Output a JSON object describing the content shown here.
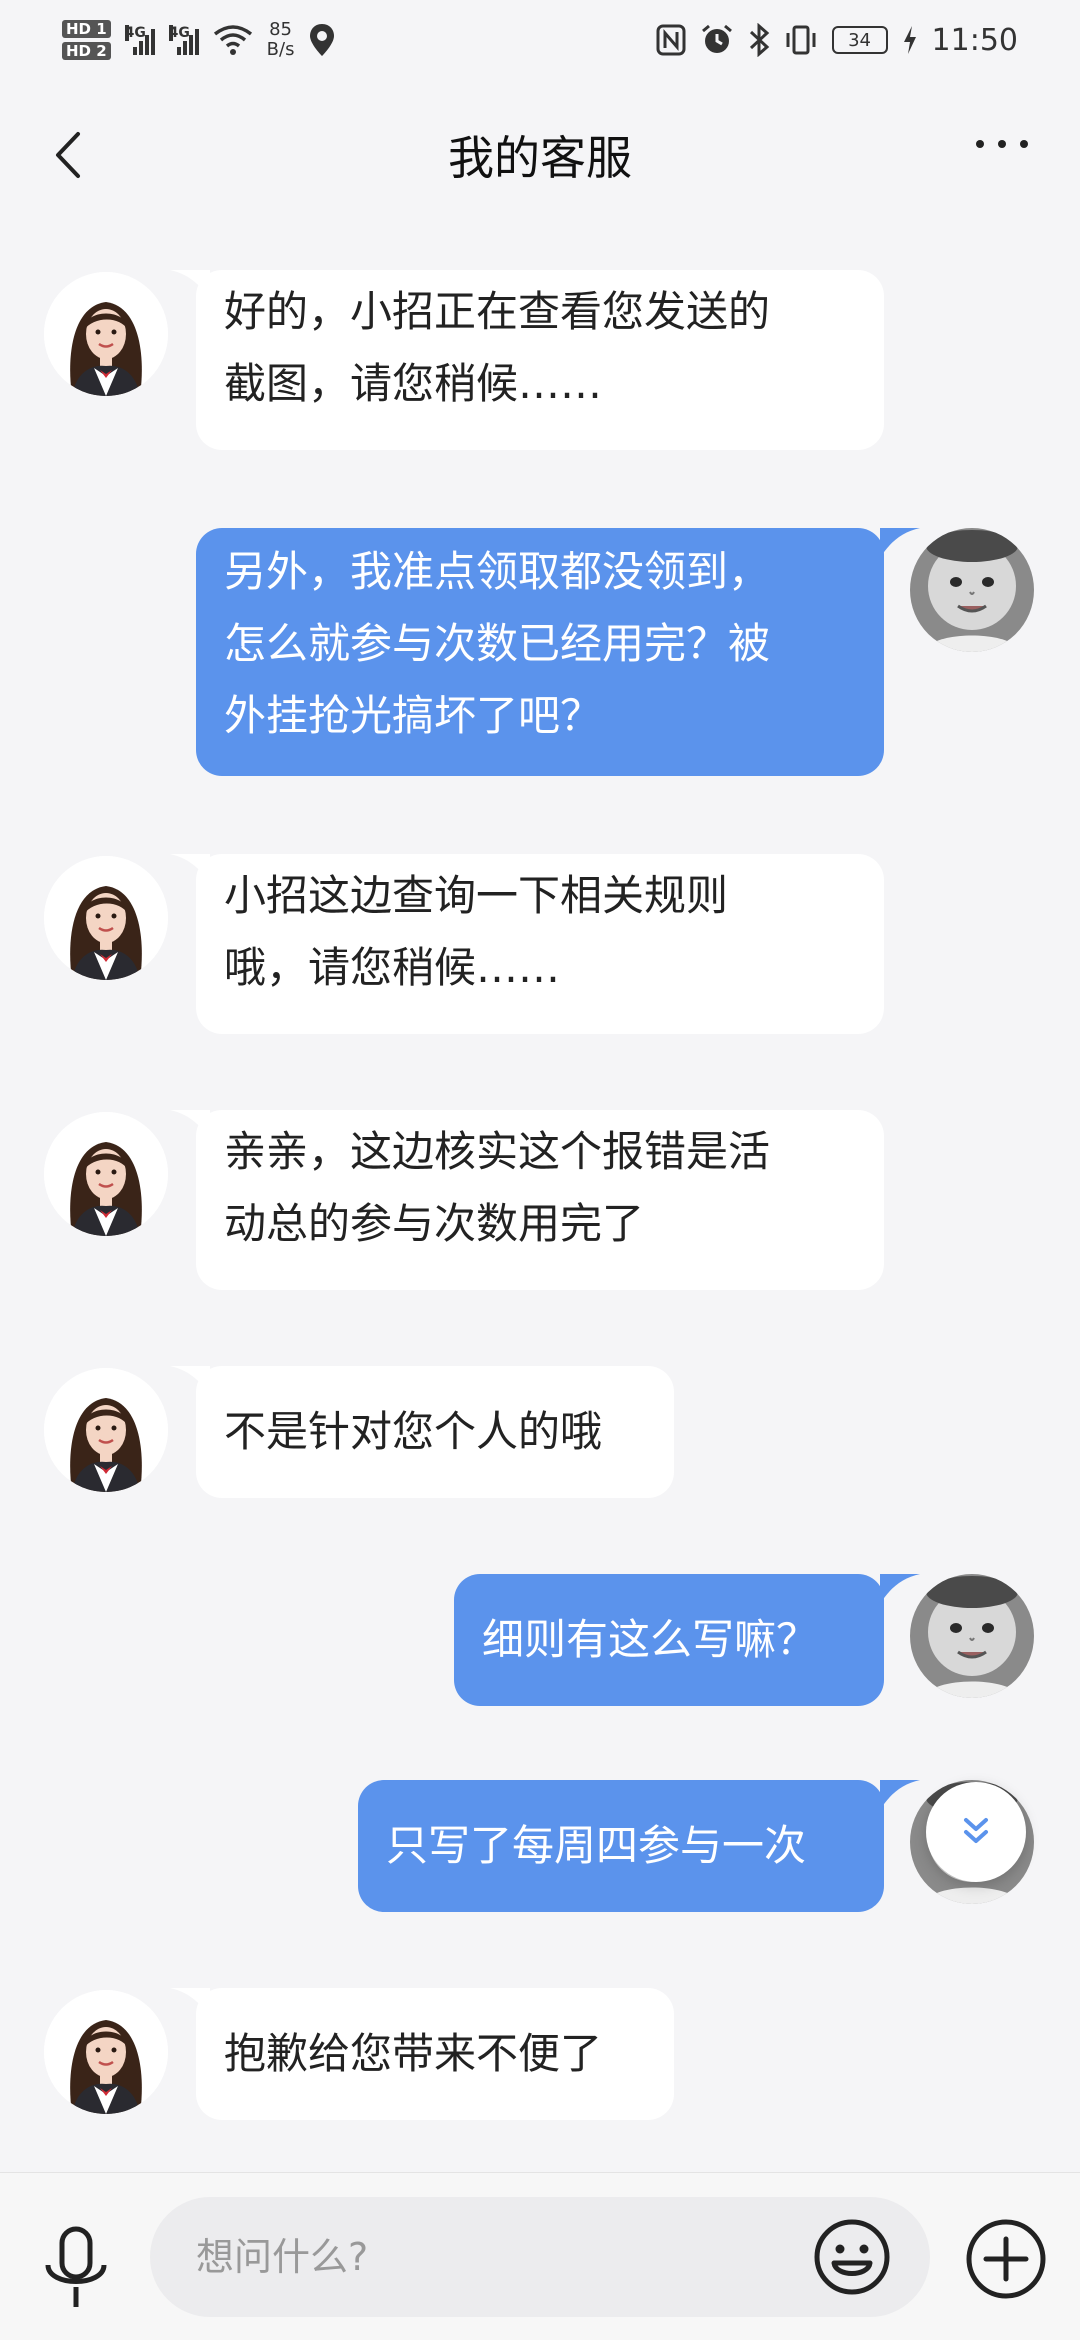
{
  "status_bar": {
    "hd1": "HD 1",
    "hd2": "HD 2",
    "net1": "4G",
    "net2": "4G",
    "speed_value": "85",
    "speed_unit": "B/s",
    "battery": "34",
    "time": "11:50"
  },
  "header": {
    "title": "我的客服"
  },
  "messages": [
    {
      "side": "in",
      "lines": [
        "好的，小招正在查看您发送的",
        "截图，请您稍候……"
      ]
    },
    {
      "side": "out",
      "lines": [
        "另外，我准点领取都没领到，",
        "怎么就参与次数已经用完？被",
        "外挂抢光搞坏了吧？"
      ]
    },
    {
      "side": "in",
      "lines": [
        "小招这边查询一下相关规则",
        "哦，请您稍候……"
      ]
    },
    {
      "side": "in",
      "lines": [
        "亲亲，这边核实这个报错是活",
        "动总的参与次数用完了"
      ]
    },
    {
      "side": "in",
      "lines": [
        "不是针对您个人的哦"
      ]
    },
    {
      "side": "out",
      "lines": [
        "细则有这么写嘛？"
      ]
    },
    {
      "side": "out",
      "lines": [
        "只写了每周四参与一次"
      ]
    },
    {
      "side": "in",
      "lines": [
        "抱歉给您带来不便了"
      ]
    }
  ],
  "input": {
    "placeholder": "想问什么?"
  },
  "colors": {
    "outgoing_bubble": "#5b93ec",
    "incoming_bubble": "#ffffff",
    "background": "#f5f5f7"
  },
  "icons": {
    "back": "back-chevron-icon",
    "more": "more-dots-icon",
    "scroll": "double-chevron-down-icon",
    "mic": "microphone-icon",
    "emoji": "smiley-icon",
    "plus": "plus-circle-icon"
  }
}
